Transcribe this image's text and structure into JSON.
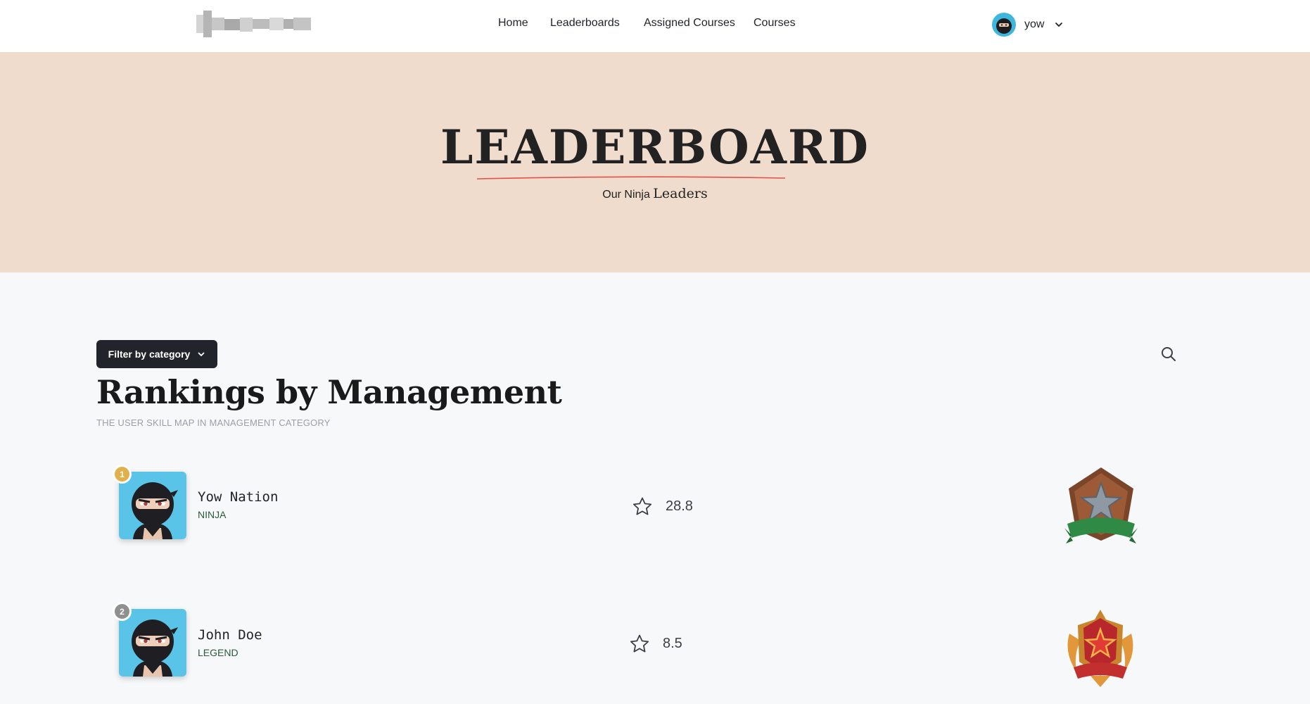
{
  "nav": {
    "links": [
      "Home",
      "Leaderboards",
      "Assigned Courses",
      "Courses"
    ],
    "user_name": "yow"
  },
  "hero": {
    "title": "LEADERBOARD",
    "subtitle_prefix": "Our Ninja",
    "subtitle_highlight": "Leaders"
  },
  "main": {
    "filter_label": "Filter by category",
    "title": "Rankings by Management",
    "subtitle": "THE USER SKILL MAP IN MANAGEMENT CATEGORY"
  },
  "rankings": [
    {
      "rank": "1",
      "name": "Yow Nation",
      "title": "NINJA",
      "score": "28.8",
      "badge_color": "#e0b04a",
      "medal": "star-shield-medal-icon"
    },
    {
      "rank": "2",
      "name": "John Doe",
      "title": "LEGEND",
      "score": "8.5",
      "badge_color": "#8f8f8f",
      "medal": "winged-star-medal-icon"
    }
  ],
  "colors": {
    "hero_bg": "#f0dccd",
    "accent_line": "#e0524a",
    "filter_bg": "#21252b"
  }
}
